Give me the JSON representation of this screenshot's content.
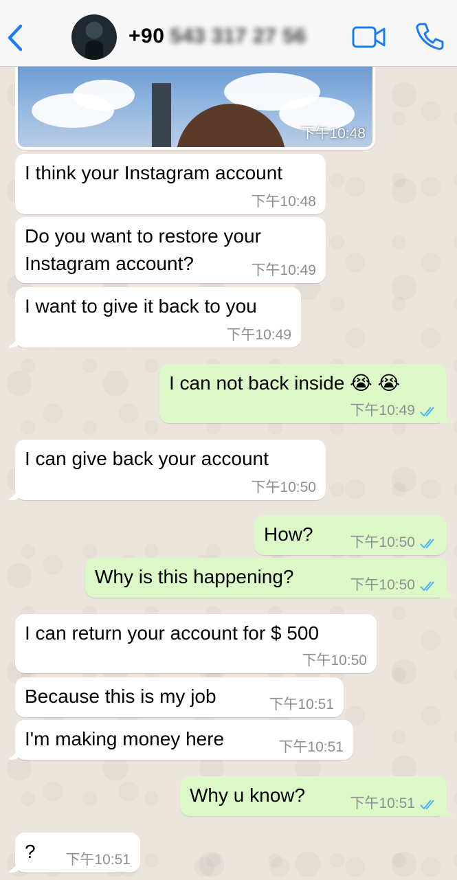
{
  "header": {
    "contact_prefix": "+90",
    "contact_blurred": "543 317 27 56"
  },
  "photo": {
    "time": "下午10:48"
  },
  "messages": [
    {
      "dir": "in",
      "text": "I think your Instagram account",
      "time": "下午10:48"
    },
    {
      "dir": "in",
      "text": "Do you want to restore your\nInstagram account?",
      "time": "下午10:49"
    },
    {
      "dir": "in",
      "text": "I want to give it back to you",
      "time": "下午10:49"
    },
    {
      "dir": "out",
      "text": "I can not back inside 😭 😭",
      "time": "下午10:49",
      "read": true
    },
    {
      "dir": "in",
      "text": "I can give back your account",
      "time": "下午10:50"
    },
    {
      "dir": "out",
      "text": "How?",
      "time": "下午10:50",
      "read": true
    },
    {
      "dir": "out",
      "text": "Why is this happening?",
      "time": "下午10:50",
      "read": true
    },
    {
      "dir": "in",
      "text": "I can return your account for $ 500",
      "time": "下午10:50"
    },
    {
      "dir": "in",
      "text": "Because this is my job",
      "time": "下午10:51"
    },
    {
      "dir": "in",
      "text": "I'm making money here",
      "time": "下午10:51"
    },
    {
      "dir": "out",
      "text": "Why u know?",
      "time": "下午10:51",
      "read": true
    },
    {
      "dir": "in",
      "text": "?",
      "time": "下午10:51"
    }
  ],
  "colors": {
    "accent": "#1a7cf5",
    "incoming_bubble": "#ffffff",
    "outgoing_bubble": "#dcf8c6",
    "read_ticks": "#4fb3f6",
    "wallpaper": "#ece5dd"
  }
}
